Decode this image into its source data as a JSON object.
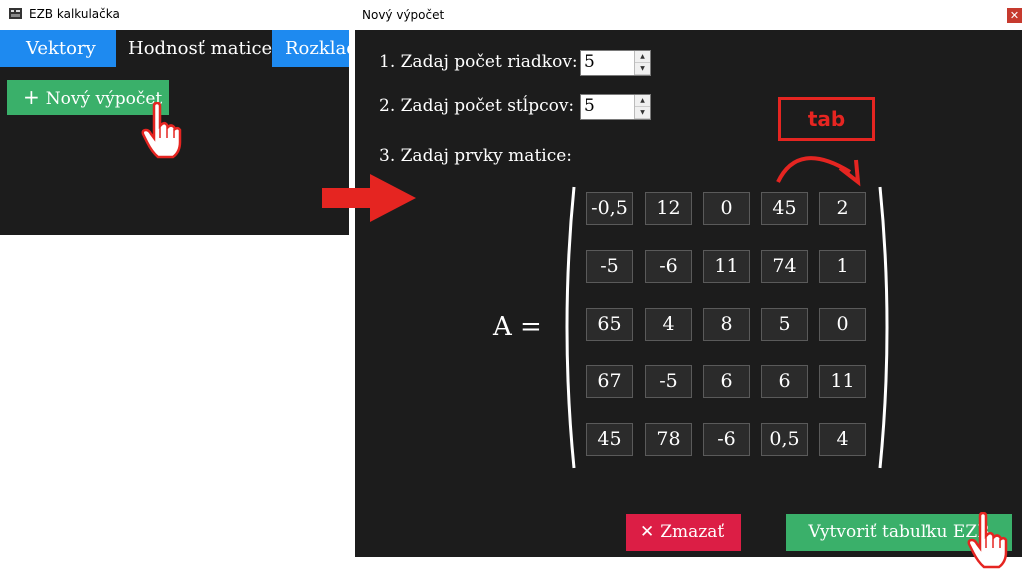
{
  "main_window": {
    "title": "EZB kalkulačka",
    "tabs": [
      {
        "label": "Vektory",
        "active": false
      },
      {
        "label": "Hodnosť matice",
        "active": true
      },
      {
        "label": "Rozklad",
        "active": false
      }
    ],
    "new_calc_button": {
      "icon": "plus-icon",
      "label": "Nový výpočet"
    }
  },
  "dialog": {
    "title": "Nový výpočet",
    "close_icon": "close-icon",
    "rows_label": "1. Zadaj počet riadkov:",
    "rows_value": "5",
    "cols_label": "2. Zadaj počet stĺpcov:",
    "cols_value": "5",
    "elements_label": "3. Zadaj prvky matice:",
    "matrix_label": "A  =",
    "matrix": [
      [
        "-0,5",
        "12",
        "0",
        "45",
        "2"
      ],
      [
        "-5",
        "-6",
        "11",
        "74",
        "1"
      ],
      [
        "65",
        "4",
        "8",
        "5",
        "0"
      ],
      [
        "67",
        "-5",
        "6",
        "6",
        "11"
      ],
      [
        "45",
        "78",
        "-6",
        "0,5",
        "4"
      ]
    ],
    "clear_button": {
      "icon": "x-icon",
      "label": "Zmazať"
    },
    "create_button": {
      "label": "Vytvoriť tabuľku EZB"
    }
  },
  "annotations": {
    "tab_hint": "tab",
    "accent_color": "#e52521"
  },
  "colors": {
    "background_dark": "#1c1c1c",
    "tab_blue": "#1e8af0",
    "button_green": "#3ab06a",
    "button_red": "#dc1e45"
  }
}
